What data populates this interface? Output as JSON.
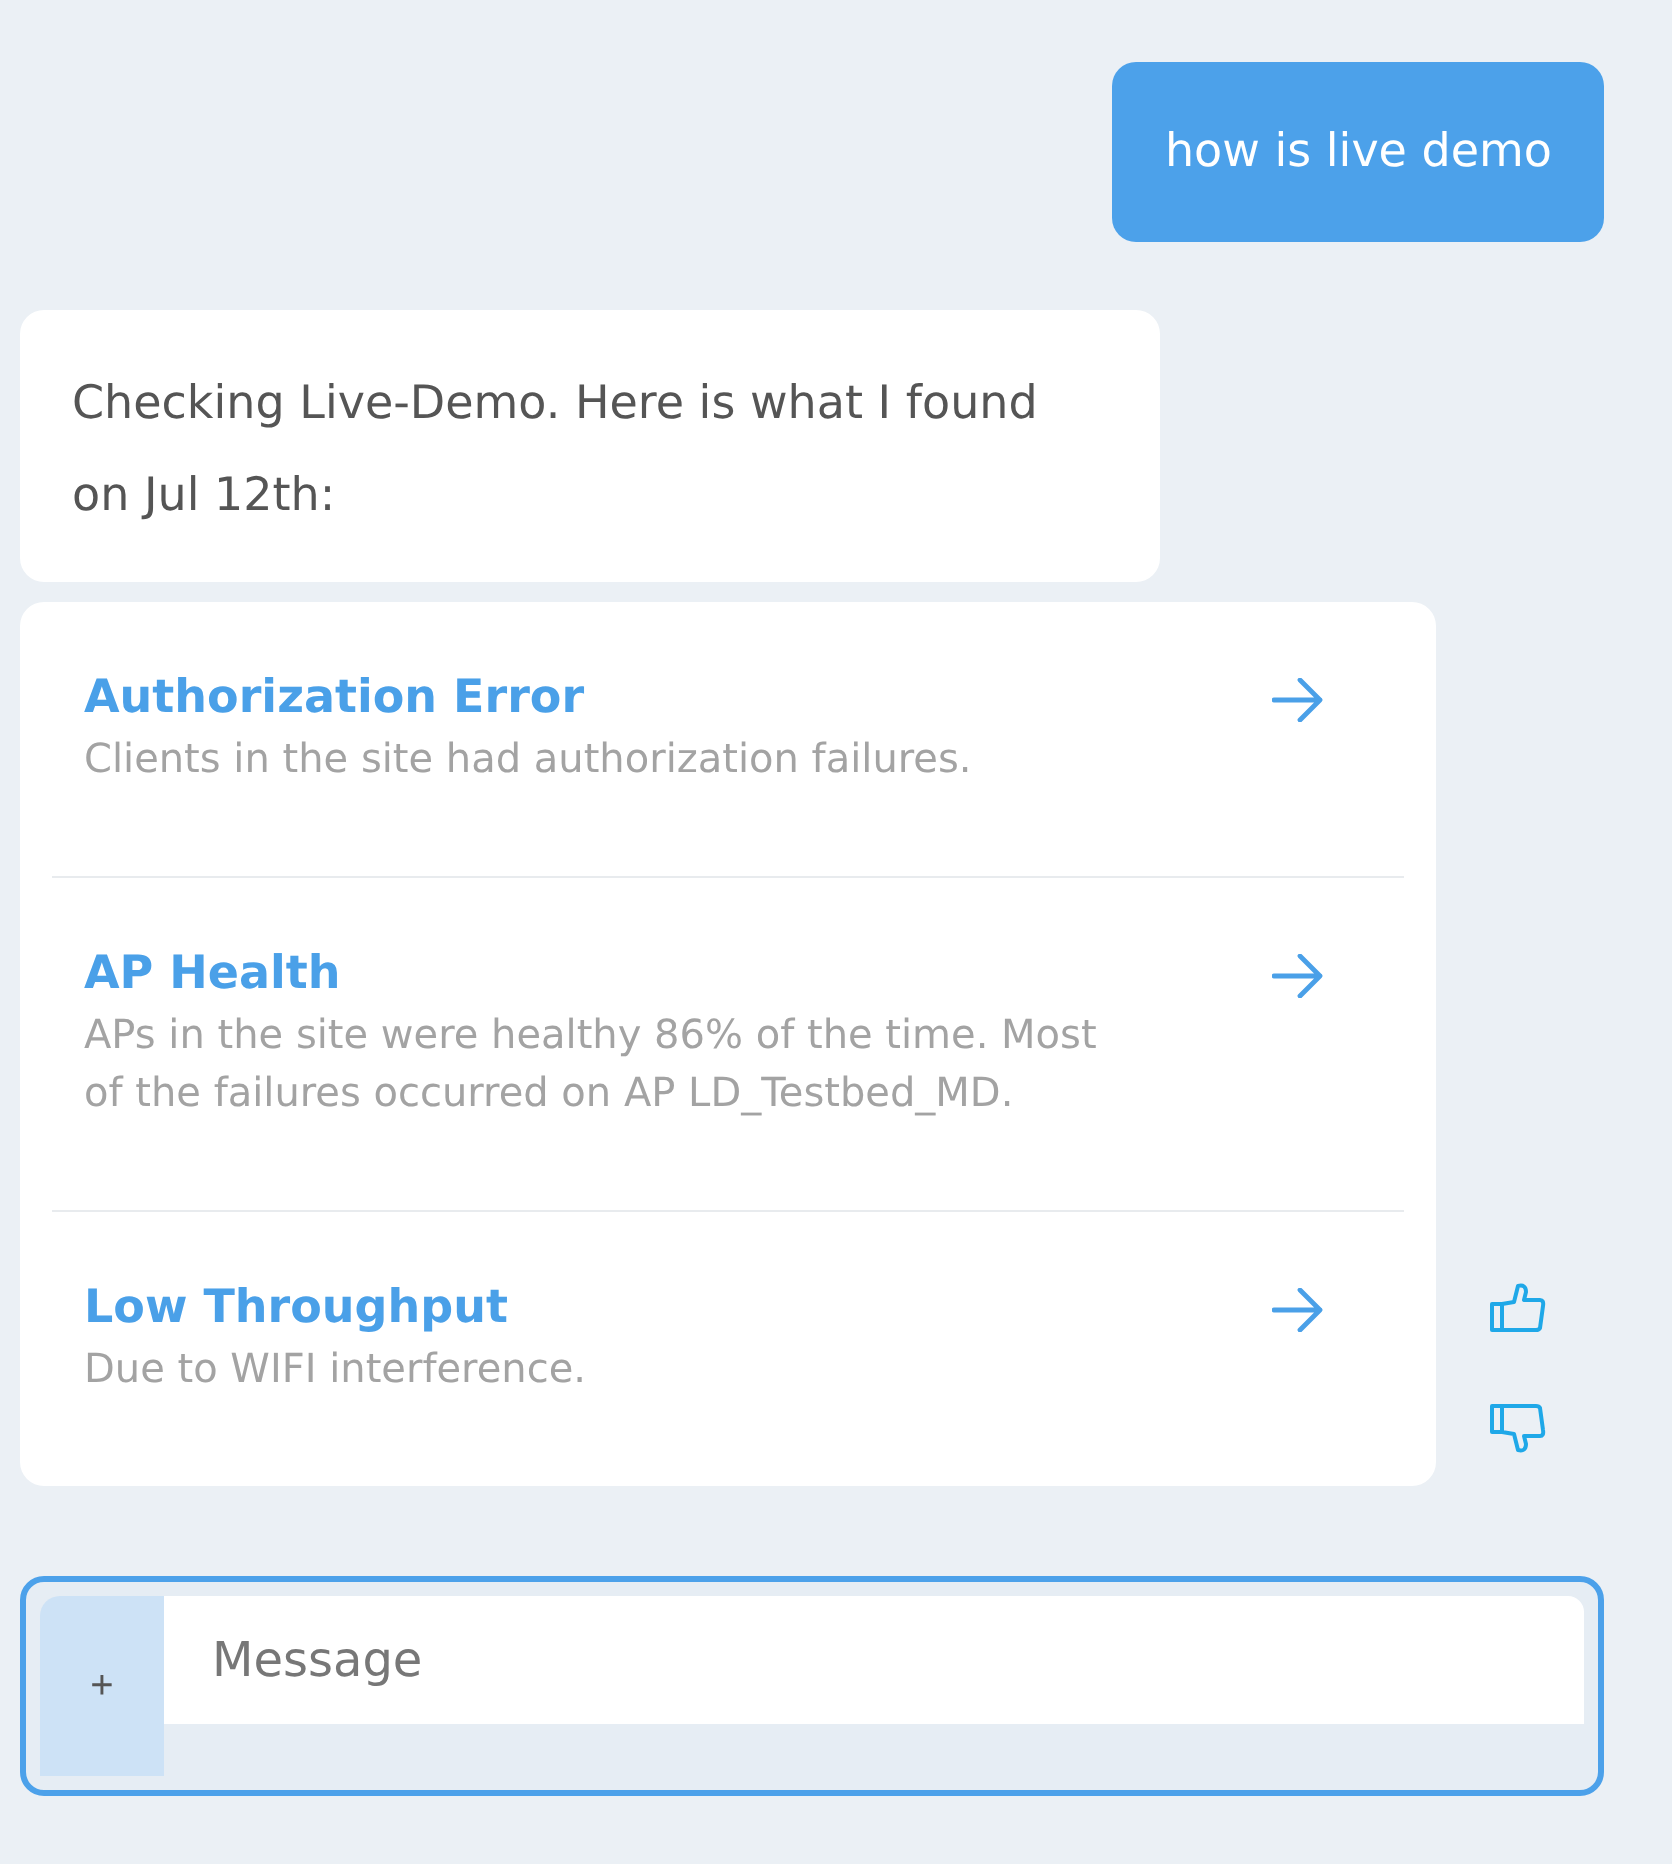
{
  "messages": [
    {
      "kind": "user",
      "text": "how is live demo"
    },
    {
      "kind": "bot",
      "text": "Checking Live-Demo. Here is what I found on Jul 12th:"
    }
  ],
  "findings": [
    {
      "title": "Authorization Error",
      "description": "Clients in the site had authorization failures."
    },
    {
      "title": "AP Health",
      "description": "APs in the site were healthy 86% of the time. Most of the failures occurred on AP LD_Testbed_MD."
    },
    {
      "title": "Low Throughput",
      "description": "Due to WIFI interference."
    }
  ],
  "composer": {
    "button": "+",
    "placeholder": "Message"
  }
}
